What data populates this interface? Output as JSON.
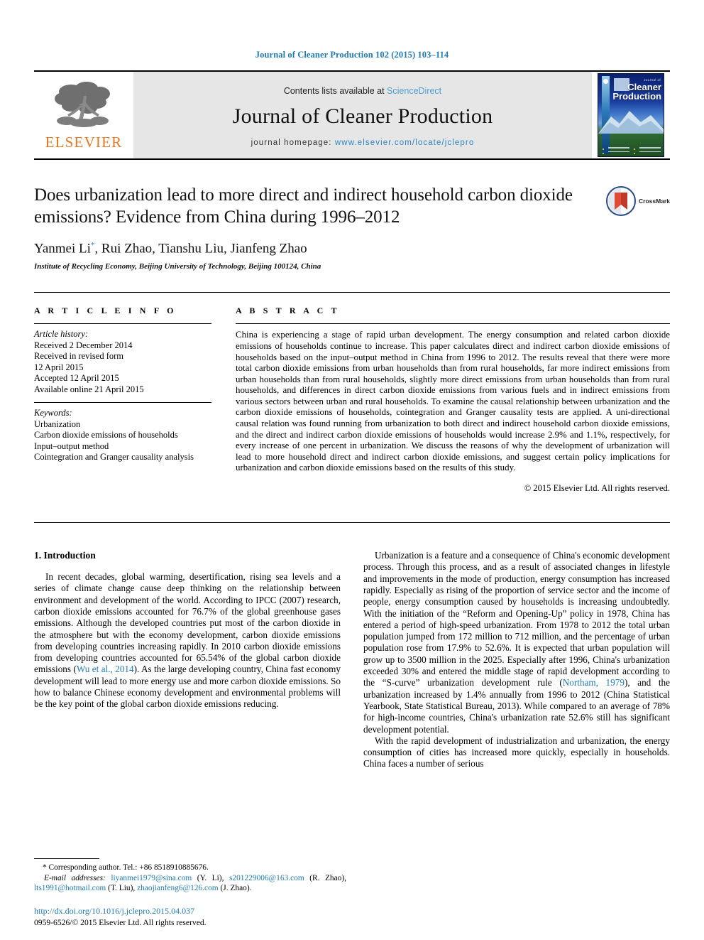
{
  "running_head": "Journal of Cleaner Production 102 (2015) 103–114",
  "masthead": {
    "publisher_name": "ELSEVIER",
    "contents_prefix": "Contents lists available at ",
    "contents_link": "ScienceDirect",
    "journal_name": "Journal of Cleaner Production",
    "homepage_prefix": "journal homepage: ",
    "homepage_url": "www.elsevier.com/locate/jclepro",
    "cover_journal_of": "Journal of",
    "cover_title_line1": "Cleaner",
    "cover_title_line2": "Production"
  },
  "article": {
    "title": "Does urbanization lead to more direct and indirect household carbon dioxide emissions? Evidence from China during 1996–2012",
    "authors": "Yanmei Li",
    "authors_rest": ", Rui Zhao, Tianshu Liu, Jianfeng Zhao",
    "corresponding_marker": "*",
    "affiliation": "Institute of Recycling Economy, Beijing University of Technology, Beijing 100124, China",
    "crossmark_label": "CrossMark"
  },
  "article_info": {
    "heading": "A R T I C L E   I N F O",
    "history_label": "Article history:",
    "history": [
      "Received 2 December 2014",
      "Received in revised form",
      "12 April 2015",
      "Accepted 12 April 2015",
      "Available online 21 April 2015"
    ],
    "keywords_label": "Keywords:",
    "keywords": [
      "Urbanization",
      "Carbon dioxide emissions of households",
      "Input–output method",
      "Cointegration and Granger causality analysis"
    ]
  },
  "abstract": {
    "heading": "A B S T R A C T",
    "text": "China is experiencing a stage of rapid urban development. The energy consumption and related carbon dioxide emissions of households continue to increase. This paper calculates direct and indirect carbon dioxide emissions of households based on the input–output method in China from 1996 to 2012. The results reveal that there were more total carbon dioxide emissions from urban households than from rural households, far more indirect emissions from urban households than from rural households, slightly more direct emissions from urban households than from rural households, and differences in direct carbon dioxide emissions from various fuels and in indirect emissions from various sectors between urban and rural households. To examine the causal relationship between urbanization and the carbon dioxide emissions of households, cointegration and Granger causality tests are applied. A uni-directional causal relation was found running from urbanization to both direct and indirect household carbon dioxide emissions, and the direct and indirect carbon dioxide emissions of households would increase 2.9% and 1.1%, respectively, for every increase of one percent in urbanization. We discuss the reasons of why the development of urbanization will lead to more household direct and indirect carbon dioxide emissions, and suggest certain policy implications for urbanization and carbon dioxide emissions based on the results of this study.",
    "copyright": "© 2015 Elsevier Ltd. All rights reserved."
  },
  "body": {
    "section_title": "1. Introduction",
    "left_para_1_a": "In recent decades, global warming, desertification, rising sea levels and a series of climate change cause deep thinking on the relationship between environment and development of the world. According to IPCC (2007) research, carbon dioxide emissions accounted for 76.7% of the global greenhouse gases emissions. Although the developed countries put most of the carbon dioxide in the atmosphere but with the economy development, carbon dioxide emissions from developing countries increasing rapidly. In 2010 carbon dioxide emissions from developing countries accounted for 65.54% of the global carbon dioxide emissions (",
    "left_para_1_ref": "Wu et al., 2014",
    "left_para_1_b": "). As the large developing country, China fast economy development will lead to more energy use and more carbon dioxide emissions. So how to balance Chinese economy development and environmental problems will be the key point of the global carbon dioxide emissions reducing.",
    "right_para_1": "Urbanization is a feature and a consequence of China's economic development process. Through this process, and as a result of associated changes in lifestyle and improvements in the mode of production, energy consumption has increased rapidly. Especially as rising of the proportion of service sector and the income of people, energy consumption caused by households is increasing undoubtedly. With the initiation of the “Reform and Opening-Up” policy in 1978, China has entered a period of high-speed urbanization. From 1978 to 2012 the total urban population jumped from 172 million to 712 million, and the percentage of urban population rose from 17.9% to 52.6%. It is expected that urban population will grow up to 3500 million in the 2025. Especially after 1996, China's urbanization exceeded 30% and entered the middle stage of rapid development according to the “S-curve” urbanization development rule (",
    "right_para_1_ref": "Northam, 1979",
    "right_para_1_b": "), and the urbanization increased by 1.4% annually from 1996 to 2012 (China Statistical Yearbook, State Statistical Bureau, 2013). While compared to an average of 78% for high-income countries, China's urbanization rate 52.6% still has significant development potential.",
    "right_para_2": "With the rapid development of industrialization and urbanization, the energy consumption of cities has increased more quickly, especially in households. China faces a number of serious"
  },
  "footnote": {
    "corresponding": "* Corresponding author. Tel.: +86 8518910885676.",
    "email_label": "E-mail addresses:",
    "emails": [
      {
        "address": "liyanmei1979@sina.com",
        "name": "(Y. Li),"
      },
      {
        "address": "s201229006@163.com",
        "name": "(R. Zhao),"
      },
      {
        "address": "lts1991@hotmail.com",
        "name": "(T. Liu),"
      },
      {
        "address": "zhaojianfeng6@126.com",
        "name": "(J. Zhao)."
      }
    ]
  },
  "footer": {
    "doi": "http://dx.doi.org/10.1016/j.jclepro.2015.04.037",
    "issn": "0959-6526/© 2015 Elsevier Ltd. All rights reserved."
  }
}
